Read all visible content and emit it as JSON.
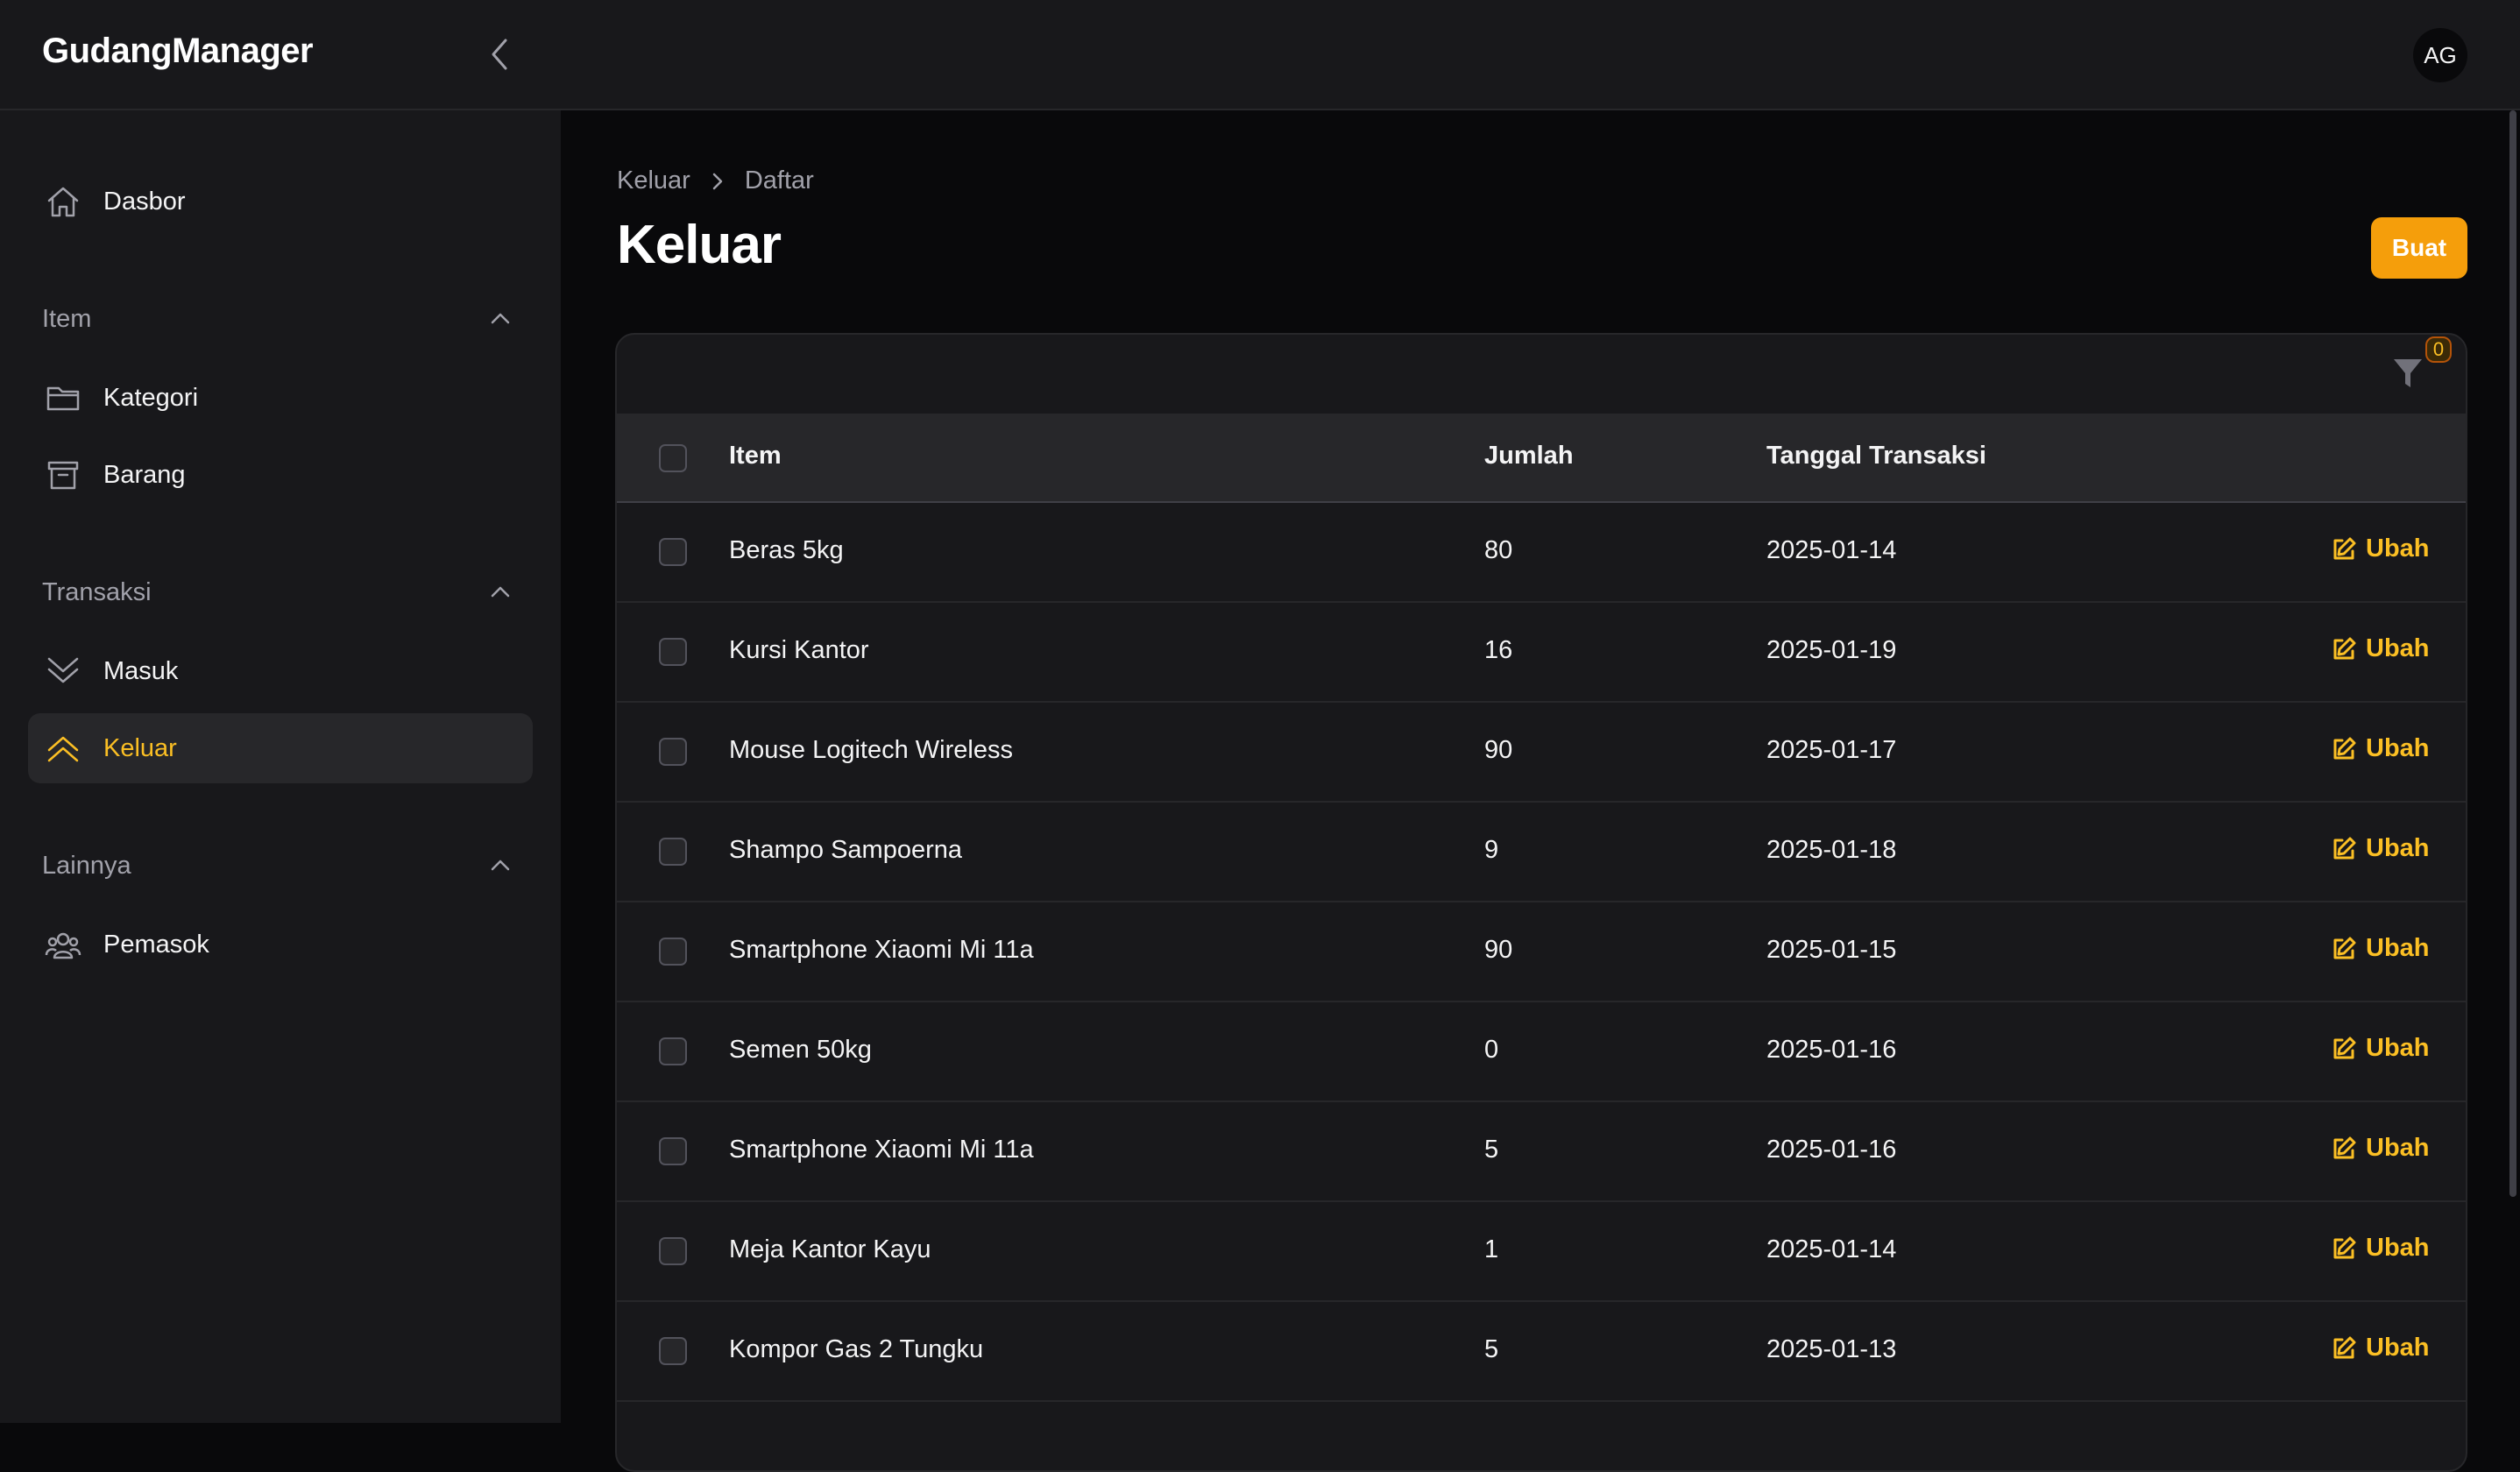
{
  "app": {
    "brand": "GudangManager",
    "user_initials": "AG"
  },
  "sidebar": {
    "dashboard": "Dasbor",
    "groups": [
      {
        "label": "Item",
        "items": [
          {
            "label": "Kategori",
            "icon": "folder-icon"
          },
          {
            "label": "Barang",
            "icon": "archive-box-icon"
          }
        ]
      },
      {
        "label": "Transaksi",
        "items": [
          {
            "label": "Masuk",
            "icon": "chevron-double-down-icon"
          },
          {
            "label": "Keluar",
            "icon": "chevron-double-up-icon",
            "active": true
          }
        ]
      },
      {
        "label": "Lainnya",
        "items": [
          {
            "label": "Pemasok",
            "icon": "user-group-icon"
          }
        ]
      }
    ]
  },
  "breadcrumb": [
    "Keluar",
    "Daftar"
  ],
  "page": {
    "title": "Keluar",
    "create_label": "Buat"
  },
  "table": {
    "filter_count": "0",
    "columns": {
      "item": "Item",
      "qty": "Jumlah",
      "date": "Tanggal Transaksi"
    },
    "edit_label": "Ubah",
    "rows": [
      {
        "item": "Beras 5kg",
        "qty": "80",
        "date": "2025-01-14"
      },
      {
        "item": "Kursi Kantor",
        "qty": "16",
        "date": "2025-01-19"
      },
      {
        "item": "Mouse Logitech Wireless",
        "qty": "90",
        "date": "2025-01-17"
      },
      {
        "item": "Shampo Sampoerna",
        "qty": "9",
        "date": "2025-01-18"
      },
      {
        "item": "Smartphone Xiaomi Mi 11a",
        "qty": "90",
        "date": "2025-01-15"
      },
      {
        "item": "Semen 50kg",
        "qty": "0",
        "date": "2025-01-16"
      },
      {
        "item": "Smartphone Xiaomi Mi 11a",
        "qty": "5",
        "date": "2025-01-16"
      },
      {
        "item": "Meja Kantor Kayu",
        "qty": "1",
        "date": "2025-01-14"
      },
      {
        "item": "Kompor Gas 2 Tungku",
        "qty": "5",
        "date": "2025-01-13"
      }
    ]
  },
  "colors": {
    "accent": "#f59e0b",
    "accent_text": "#fbbf24",
    "background": "#09090b",
    "surface": "#18181b"
  }
}
